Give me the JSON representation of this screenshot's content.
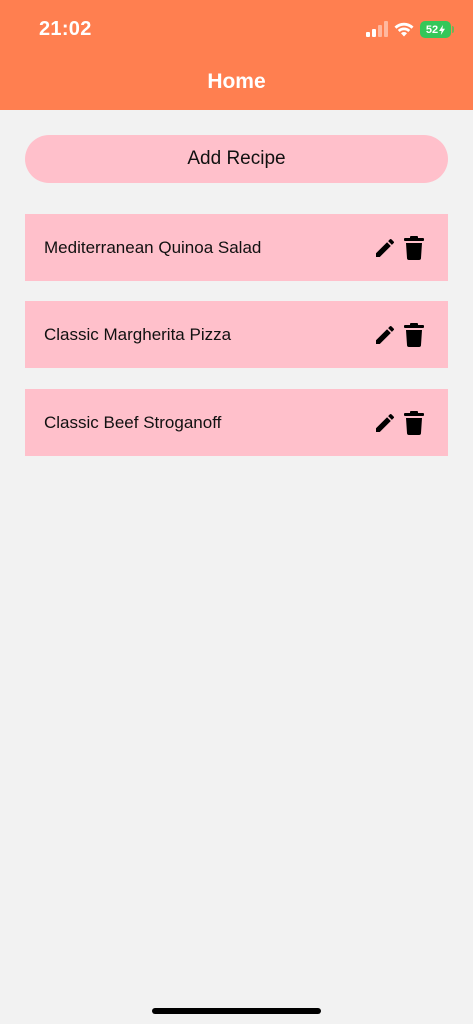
{
  "status_bar": {
    "time": "21:02",
    "battery_level": "52",
    "signal_icon": "signal-bars-icon",
    "wifi_icon": "wifi-icon",
    "battery_icon": "battery-charging-icon"
  },
  "header": {
    "title": "Home",
    "color": "#ff7f50"
  },
  "main": {
    "add_button_label": "Add Recipe",
    "accent_color": "#ffc0cb",
    "recipes": [
      {
        "name": "Mediterranean Quinoa Salad"
      },
      {
        "name": "Classic Margherita Pizza"
      },
      {
        "name": "Classic Beef Stroganoff"
      }
    ],
    "item_actions": [
      "pencil-edit-icon",
      "trash-delete-icon"
    ]
  }
}
